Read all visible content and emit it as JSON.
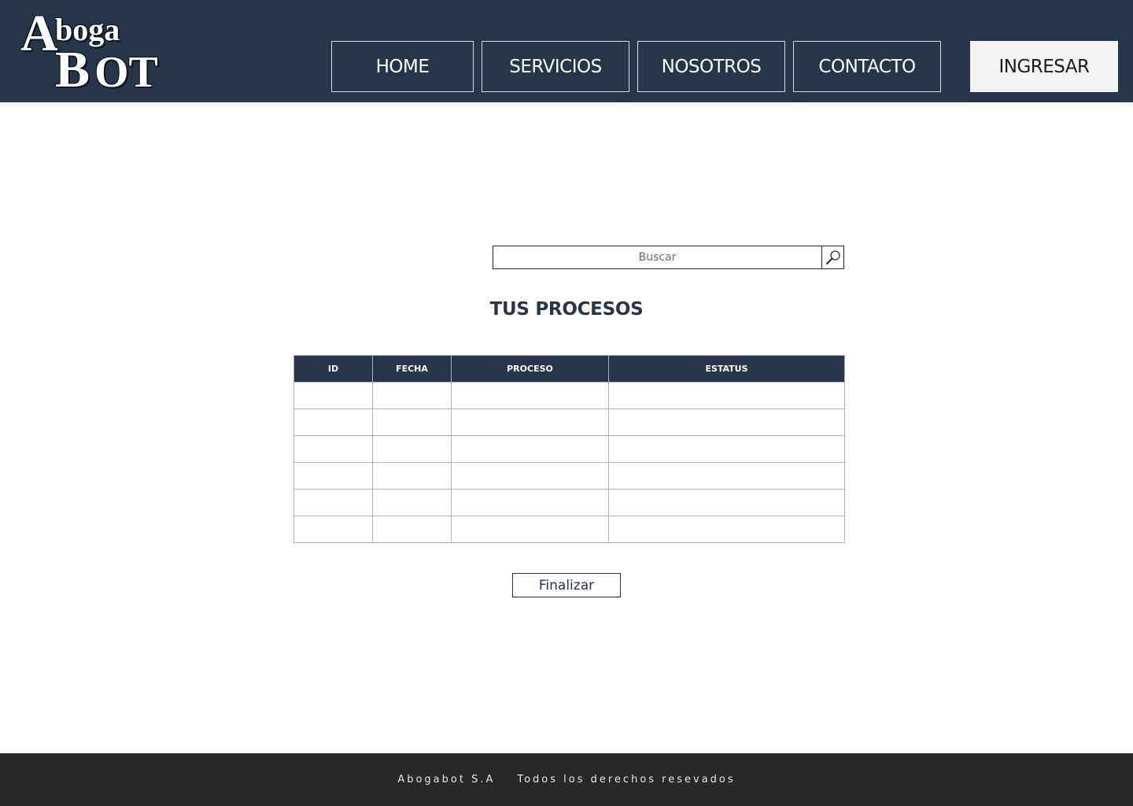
{
  "brand": {
    "logo_line1_initial": "A",
    "logo_line1_rest": "boga",
    "logo_line2_initial": "B",
    "logo_line2_rest": "OT"
  },
  "nav": {
    "home": "HOME",
    "servicios": "SERVICIOS",
    "nosotros": "NOSOTROS",
    "contacto": "CONTACTO",
    "ingresar": "INGRESAR"
  },
  "search": {
    "placeholder": "Buscar",
    "icon": "search-icon"
  },
  "main": {
    "title": "TUS PROCESOS",
    "table": {
      "columns": [
        "ID",
        "FECHA",
        "PROCESO",
        "ESTATUS"
      ],
      "rows": [
        [
          "",
          "",
          "",
          ""
        ],
        [
          "",
          "",
          "",
          ""
        ],
        [
          "",
          "",
          "",
          ""
        ],
        [
          "",
          "",
          "",
          ""
        ],
        [
          "",
          "",
          "",
          ""
        ],
        [
          "",
          "",
          "",
          ""
        ]
      ]
    },
    "finalizar_label": "Finalizar"
  },
  "footer": {
    "company": "Abogabot S.A",
    "rights": "Todos los derechos resevados"
  },
  "colors": {
    "header_bg": "#27354a",
    "footer_bg": "#282828",
    "accent": "#27354a",
    "ingresar_bg": "#f3f3f3"
  }
}
